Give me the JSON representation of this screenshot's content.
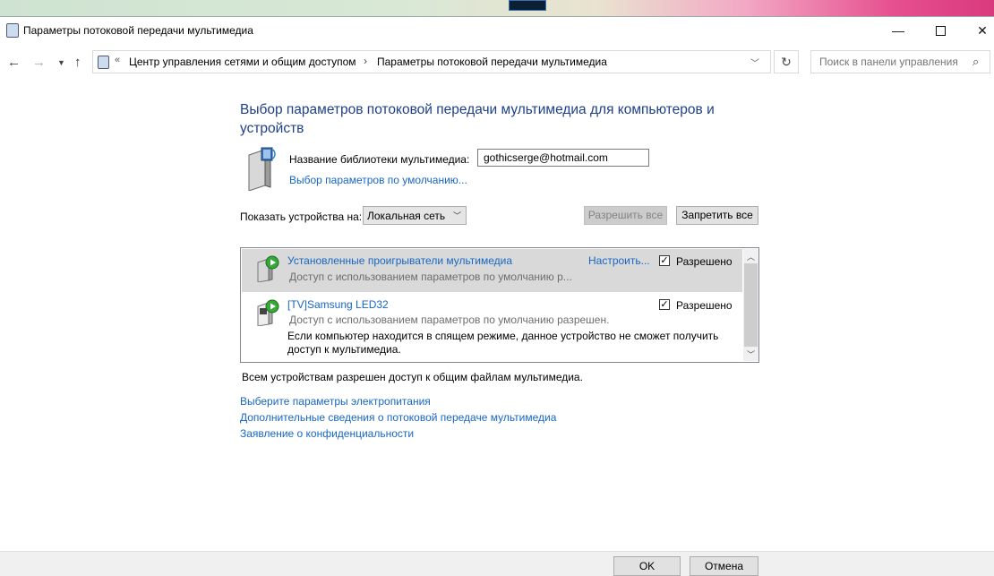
{
  "window": {
    "title": "Параметры потоковой передачи мультимедиа",
    "minimize_icon": "minimize-icon",
    "maximize_icon": "maximize-icon",
    "close_icon": "close-icon"
  },
  "nav": {
    "back_icon": "arrow-left-icon",
    "forward_icon": "arrow-right-icon",
    "up_icon": "arrow-up-icon",
    "address": {
      "overflow": "«",
      "crumbs": [
        "Центр управления сетями и общим доступом",
        "Параметры потоковой передачи мультимедиа"
      ],
      "separator": "›"
    },
    "search": {
      "placeholder": "Поиск в панели управления"
    }
  },
  "main": {
    "heading": "Выбор параметров потоковой передачи мультимедиа для компьютеров и устройств",
    "library_label": "Название библиотеки мультимедиа:",
    "library_name": "gothicserge@hotmail.com",
    "defaults_link": "Выбор параметров по умолчанию...",
    "show_devices_label": "Показать устройства на:",
    "network_select": "Локальная сеть",
    "allow_all": "Разрешить все",
    "deny_all": "Запретить все",
    "devices": [
      {
        "name": "Установленные проигрыватели мультимедиа",
        "description": "Доступ с использованием параметров по умолчанию р...",
        "configure": "Настроить...",
        "allowed_label": "Разрешено",
        "checked": true,
        "selected": true
      },
      {
        "name": "[TV]Samsung LED32",
        "description": "Доступ с использованием параметров по умолчанию разрешен.",
        "warning": "Если компьютер находится в спящем режиме, данное устройство не сможет получить доступ к мультимедиа.",
        "allowed_label": "Разрешено",
        "checked": true,
        "selected": false
      }
    ],
    "all_allowed_text": "Всем устройствам разрешен доступ к общим файлам мультимедиа.",
    "links": {
      "power": "Выберите параметры электропитания",
      "info": "Дополнительные сведения о потоковой передаче мультимедиа",
      "privacy": "Заявление о конфиденциальности"
    }
  },
  "footer": {
    "ok": "OK",
    "cancel": "Отмена"
  },
  "colors": {
    "heading": "#1e3f8a",
    "link": "#1767c3",
    "selected_row": "#d9d9d9"
  }
}
